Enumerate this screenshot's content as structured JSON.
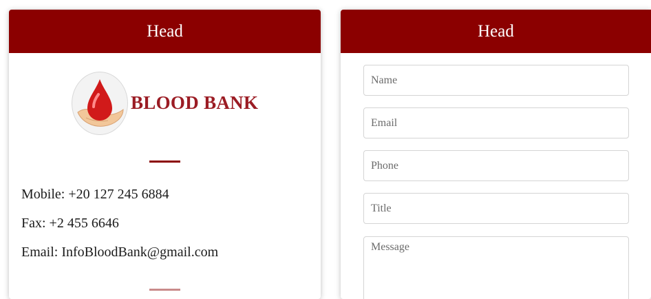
{
  "left_card": {
    "head": "Head",
    "logo_text": "BLOOD BANK",
    "mobile": "Mobile: +20 127 245 6884",
    "fax": "Fax: +2 455 6646",
    "email": "Email: InfoBloodBank@gmail.com"
  },
  "right_card": {
    "head": "Head",
    "form": {
      "name_placeholder": "Name",
      "email_placeholder": "Email",
      "phone_placeholder": "Phone",
      "title_placeholder": "Title",
      "message_placeholder": "Message"
    }
  },
  "colors": {
    "header_bg": "#8b0000",
    "logo_text": "#9b1c24",
    "drop": "#d11a1a"
  },
  "icons": {
    "logo": "blood-drop-hand-icon"
  }
}
